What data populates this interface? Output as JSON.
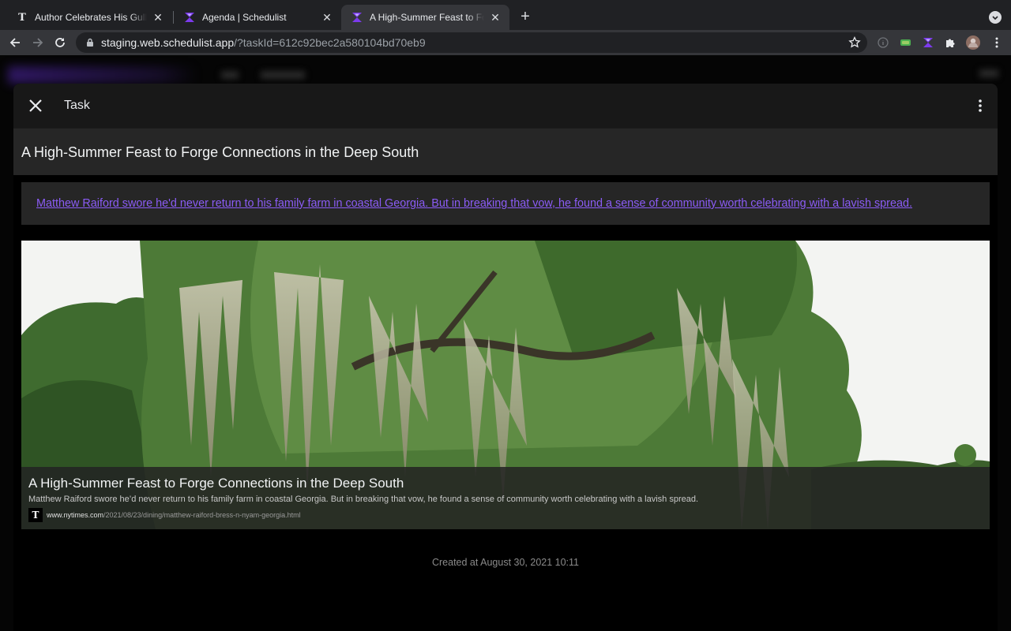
{
  "browser": {
    "tabs": [
      {
        "title": "Author Celebrates His Gullah Roots",
        "favicon": "nyt-icon",
        "active": false
      },
      {
        "title": "Agenda | Schedulist",
        "favicon": "schedulist-icon",
        "active": false
      },
      {
        "title": "A High-Summer Feast to Forge Connections",
        "favicon": "schedulist-icon",
        "active": true
      }
    ],
    "url_host": "staging.web.schedulist.app",
    "url_path": "/?taskId=612c92bec2a580104bd70eb9"
  },
  "dialog": {
    "header_title": "Task",
    "task_title": "A High-Summer Feast to Forge Connections in the Deep South",
    "description_link": "Matthew Raiford swore he'd never return to his family farm in coastal Georgia. But in breaking that vow, he found a sense of community worth celebrating with a lavish spread.",
    "preview": {
      "title": "A High-Summer Feast to Forge Connections in the Deep South",
      "description": "Matthew Raiford swore he’d never return to his family farm in coastal Georgia. But in breaking that vow, he found a sense of community worth celebrating with a lavish spread.",
      "source_domain": "www.nytimes.com",
      "source_path": "/2021/08/23/dining/matthew-raiford-bress-n-nyam-georgia.html",
      "source_logo": "T"
    },
    "created_at": "Created at August 30, 2021 10:11"
  },
  "colors": {
    "accent": "#8b5cf6",
    "schedulist_brand": "#7c3aed"
  }
}
